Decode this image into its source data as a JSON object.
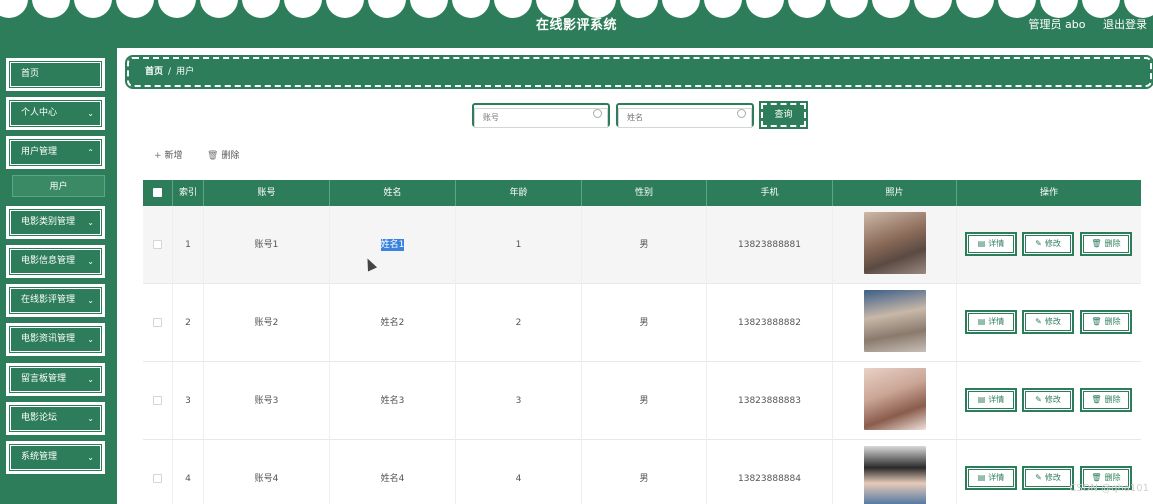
{
  "header": {
    "title": "在线影评系统",
    "user_label": "管理员 abo",
    "logout_label": "退出登录"
  },
  "sidebar": {
    "items": [
      {
        "label": "首页",
        "has_chevron": false
      },
      {
        "label": "个人中心",
        "has_chevron": true
      },
      {
        "label": "用户管理",
        "has_chevron": true
      },
      {
        "label": "电影类别管理",
        "has_chevron": true
      },
      {
        "label": "电影信息管理",
        "has_chevron": true
      },
      {
        "label": "在线影评管理",
        "has_chevron": true
      },
      {
        "label": "电影资讯管理",
        "has_chevron": true
      },
      {
        "label": "留言板管理",
        "has_chevron": true
      },
      {
        "label": "电影论坛",
        "has_chevron": true
      },
      {
        "label": "系统管理",
        "has_chevron": true
      }
    ],
    "sub_item": "用户"
  },
  "breadcrumb": {
    "home": "首页",
    "separator": "/",
    "current": "用户"
  },
  "search": {
    "account_placeholder": "账号",
    "name_placeholder": "姓名",
    "button": "查询"
  },
  "actions": {
    "add": "新增",
    "delete": "删除"
  },
  "table": {
    "columns": [
      "索引",
      "账号",
      "姓名",
      "年龄",
      "性别",
      "手机",
      "照片",
      "操作"
    ],
    "rows": [
      {
        "index": "1",
        "account": "账号1",
        "name": "姓名1",
        "age": "1",
        "gender": "男",
        "phone": "13823888881"
      },
      {
        "index": "2",
        "account": "账号2",
        "name": "姓名2",
        "age": "2",
        "gender": "男",
        "phone": "13823888882"
      },
      {
        "index": "3",
        "account": "账号3",
        "name": "姓名3",
        "age": "3",
        "gender": "男",
        "phone": "13823888883"
      },
      {
        "index": "4",
        "account": "账号4",
        "name": "姓名4",
        "age": "4",
        "gender": "男",
        "phone": "13823888884"
      }
    ],
    "ops": {
      "detail": "详情",
      "edit": "修改",
      "delete": "删除"
    }
  },
  "watermark": "CSDN @qha101",
  "colors": {
    "primary": "#2e7d5a",
    "highlight": "#3b82e0"
  }
}
